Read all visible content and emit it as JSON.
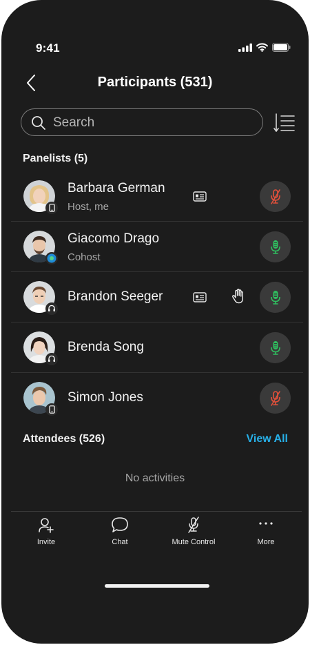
{
  "status_bar": {
    "time": "9:41"
  },
  "header": {
    "title": "Participants (531)"
  },
  "search": {
    "placeholder": "Search"
  },
  "panelists": {
    "title": "Panelists (5)",
    "items": [
      {
        "name": "Barbara German",
        "role": "Host, me",
        "mic": "muted",
        "device": "phone-icon",
        "has_card": true,
        "raised_hand": false
      },
      {
        "name": "Giacomo Drago",
        "role": "Cohost",
        "mic": "on",
        "device": "webex-app-icon",
        "has_card": false,
        "raised_hand": false
      },
      {
        "name": "Brandon Seeger",
        "role": "",
        "mic": "on",
        "device": "headset-icon",
        "has_card": true,
        "raised_hand": true
      },
      {
        "name": "Brenda Song",
        "role": "",
        "mic": "on",
        "device": "headset-icon",
        "has_card": false,
        "raised_hand": false
      },
      {
        "name": "Simon Jones",
        "role": "",
        "mic": "muted",
        "device": "phone-icon",
        "has_card": false,
        "raised_hand": false
      }
    ]
  },
  "attendees": {
    "title": "Attendees (526)",
    "view_all": "View All",
    "empty_text": "No activities"
  },
  "tabbar": {
    "items": [
      {
        "label": "Invite",
        "icon": "add-person-icon"
      },
      {
        "label": "Chat",
        "icon": "chat-bubble-icon"
      },
      {
        "label": "Mute Control",
        "icon": "mic-off-icon"
      },
      {
        "label": "More",
        "icon": "more-dots-icon"
      }
    ]
  },
  "colors": {
    "accent": "#27b0e8",
    "mic_on": "#2fbf5f",
    "mic_muted": "#e2503b",
    "background": "#1c1c1c"
  }
}
